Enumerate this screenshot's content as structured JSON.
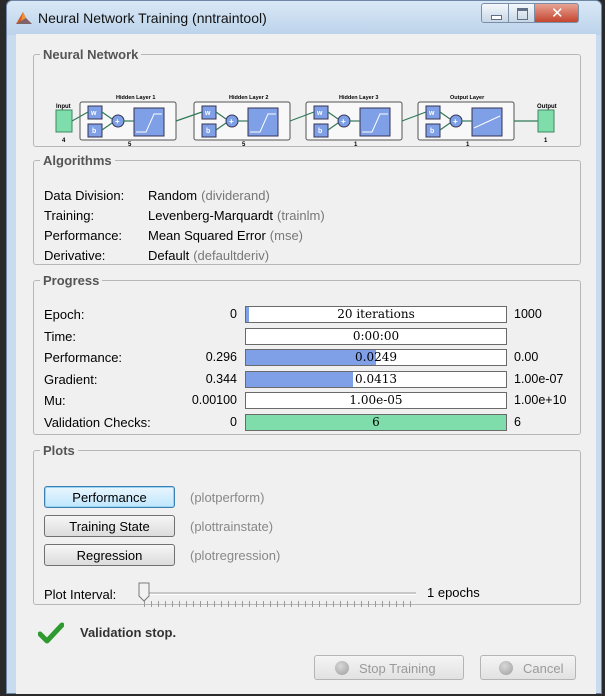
{
  "window": {
    "title": "Neural Network Training (nntraintool)"
  },
  "network": {
    "section_title": "Neural Network",
    "input_label": "Input",
    "input_size": "4",
    "layers": [
      {
        "name": "Hidden Layer 1",
        "size": "5"
      },
      {
        "name": "Hidden Layer 2",
        "size": "5"
      },
      {
        "name": "Hidden Layer 3",
        "size": "1"
      },
      {
        "name": "Output Layer",
        "size": "1"
      }
    ],
    "weight_symbol": "w",
    "bias_symbol": "b",
    "sum_symbol": "+",
    "output_label": "Output",
    "output_size": "1"
  },
  "algorithms": {
    "section_title": "Algorithms",
    "rows": [
      {
        "key": "Data Division:",
        "value": "Random",
        "fn": "(dividerand)"
      },
      {
        "key": "Training:",
        "value": "Levenberg-Marquardt",
        "fn": "(trainlm)"
      },
      {
        "key": "Performance:",
        "value": "Mean Squared Error",
        "fn": "(mse)"
      },
      {
        "key": "Derivative:",
        "value": "Default",
        "fn": "(defaultderiv)"
      }
    ]
  },
  "progress": {
    "section_title": "Progress",
    "rows": [
      {
        "label": "Epoch:",
        "start": "0",
        "current": "20 iterations",
        "end": "1000",
        "fill": 0.02,
        "color": "#7f9fe6"
      },
      {
        "label": "Time:",
        "start": "",
        "current": "0:00:00",
        "end": "",
        "fill": 0.0,
        "color": "#7f9fe6"
      },
      {
        "label": "Performance:",
        "start": "0.296",
        "current": "0.0249",
        "end": "0.00",
        "fill": 0.5,
        "color": "#7f9fe6"
      },
      {
        "label": "Gradient:",
        "start": "0.344",
        "current": "0.0413",
        "end": "1.00e-07",
        "fill": 0.41,
        "color": "#7f9fe6"
      },
      {
        "label": "Mu:",
        "start": "0.00100",
        "current": "1.00e-05",
        "end": "1.00e+10",
        "fill": 0.0,
        "color": "#7f9fe6"
      },
      {
        "label": "Validation Checks:",
        "start": "0",
        "current": "6",
        "end": "6",
        "fill": 1.0,
        "color": "#7fdcab"
      }
    ]
  },
  "plots": {
    "section_title": "Plots",
    "buttons": [
      {
        "label": "Performance",
        "fn": "(plotperform)"
      },
      {
        "label": "Training State",
        "fn": "(plottrainstate)"
      },
      {
        "label": "Regression",
        "fn": "(plotregression)"
      }
    ],
    "interval_label": "Plot Interval:",
    "interval_value": "1 epochs",
    "interval_fraction": 0.0
  },
  "status": {
    "text": "Validation stop."
  },
  "actions": {
    "stop_label": "Stop Training",
    "cancel_label": "Cancel"
  }
}
